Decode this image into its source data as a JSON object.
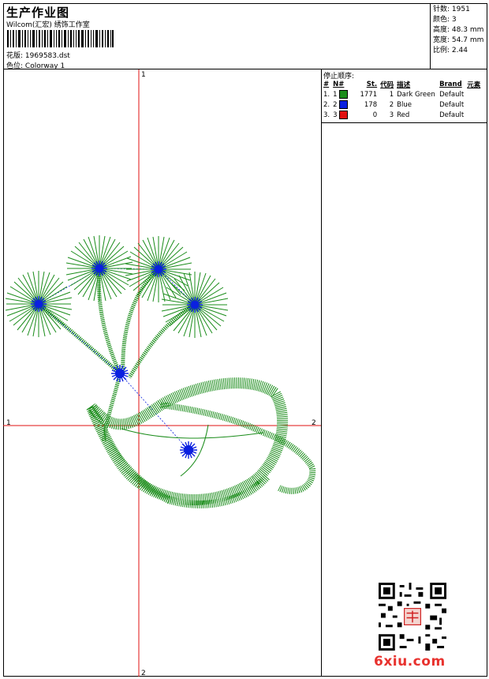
{
  "header": {
    "title": "生产作业图",
    "subtitle": "Wilcom(汇宏) 绣饰工作室",
    "design_label": "花版:",
    "design_value": "1969583.dst",
    "colorway_label": "色位:",
    "colorway_value": "Colorway 1"
  },
  "stats": [
    {
      "label": "针数:",
      "value": "1951"
    },
    {
      "label": "颜色:",
      "value": "3"
    },
    {
      "label": "高度:",
      "value": "48.3 mm"
    },
    {
      "label": "宽度:",
      "value": "54.7 mm"
    },
    {
      "label": "比例:",
      "value": "2.44"
    }
  ],
  "stops": {
    "caption": "停止顺序:",
    "columns": [
      "#",
      "N#",
      "St.",
      "代码",
      "描述",
      "Brand",
      "元素"
    ],
    "rows": [
      {
        "idx": "1.",
        "n": "1",
        "color": "#1a8c1a",
        "st": "1771",
        "code": "1",
        "desc": "Dark Green",
        "brand": "Default"
      },
      {
        "idx": "2.",
        "n": "2",
        "color": "#0b20e0",
        "st": "178",
        "code": "2",
        "desc": "Blue",
        "brand": "Default"
      },
      {
        "idx": "3.",
        "n": "3",
        "color": "#e01010",
        "st": "0",
        "code": "3",
        "desc": "Red",
        "brand": "Default"
      }
    ]
  },
  "axes": {
    "vertical_top": "1",
    "vertical_bottom": "2",
    "horizontal_left": "1",
    "horizontal_right": "2"
  },
  "colors": {
    "thread_green": "#1a8c1a",
    "thread_blue": "#0b20e0",
    "axis_red": "#e01010"
  },
  "watermark": {
    "text": "6xiu.com"
  }
}
